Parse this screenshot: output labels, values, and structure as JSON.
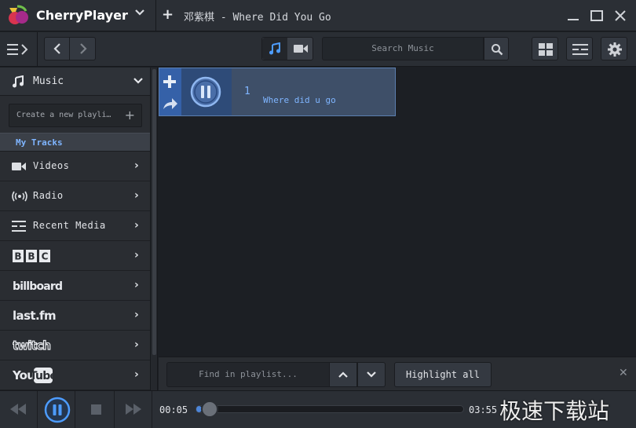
{
  "app": {
    "name": "CherryPlayer",
    "tab_title": "邓紫棋 - Where Did You Go"
  },
  "toolbar": {
    "search_placeholder": "Search Music"
  },
  "sidebar": {
    "music_label": "Music",
    "new_playlist_placeholder": "Create a new playli…",
    "my_tracks_label": "My Tracks",
    "items": [
      {
        "label": "Videos",
        "icon": "video-camera-icon"
      },
      {
        "label": "Radio",
        "icon": "radio-icon"
      },
      {
        "label": "Recent Media",
        "icon": "recent-media-icon"
      },
      {
        "brand": "BBC",
        "icon": "bbc-logo"
      },
      {
        "brand": "billboard",
        "icon": "billboard-logo"
      },
      {
        "brand": "last.fm",
        "icon": "lastfm-logo"
      },
      {
        "brand": "twitch",
        "icon": "twitch-logo"
      },
      {
        "brand": "YouTube",
        "icon": "youtube-logo"
      }
    ]
  },
  "playlist": {
    "tracks": [
      {
        "number": "1",
        "title": "Where did u go"
      }
    ]
  },
  "findbar": {
    "placeholder": "Find in playlist...",
    "highlight_label": "Highlight all"
  },
  "player": {
    "current_time": "00:05",
    "total_time": "03:55",
    "progress": 0.02
  },
  "watermark": "极速下载站",
  "colors": {
    "accent": "#4d86d9",
    "selected_text": "#7fb5ff"
  }
}
